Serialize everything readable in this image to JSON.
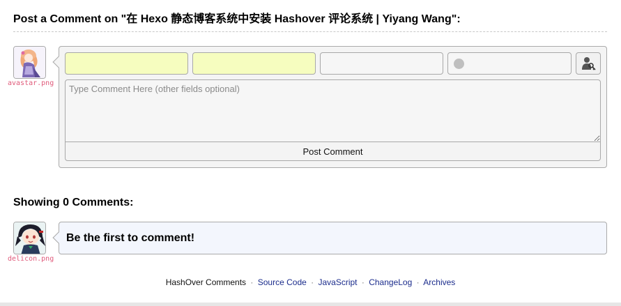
{
  "form": {
    "title": "Post a Comment on \"在 Hexo 静态博客系统中安装 Hashover 评论系统 | Yiyang Wang\":",
    "avatar_caption": "avastar.png",
    "fields": {
      "name": {
        "value": "",
        "placeholder": ""
      },
      "password": {
        "value": "",
        "placeholder": ""
      },
      "email": {
        "value": "",
        "placeholder": ""
      },
      "website": {
        "value": "",
        "placeholder": ""
      }
    },
    "comment_placeholder": "Type Comment Here (other fields optional)",
    "post_button_label": "Post Comment",
    "required_field_color": "#f6fdbf"
  },
  "comments": {
    "count_title": "Showing 0 Comments:",
    "avatar_caption": "delicon.png",
    "first_message": "Be the first to comment!"
  },
  "footer": {
    "brand": "HashOver Comments",
    "separator": "·",
    "links": [
      "Source Code",
      "JavaScript",
      "ChangeLog",
      "Archives"
    ],
    "link_color": "#1b2c8c"
  }
}
